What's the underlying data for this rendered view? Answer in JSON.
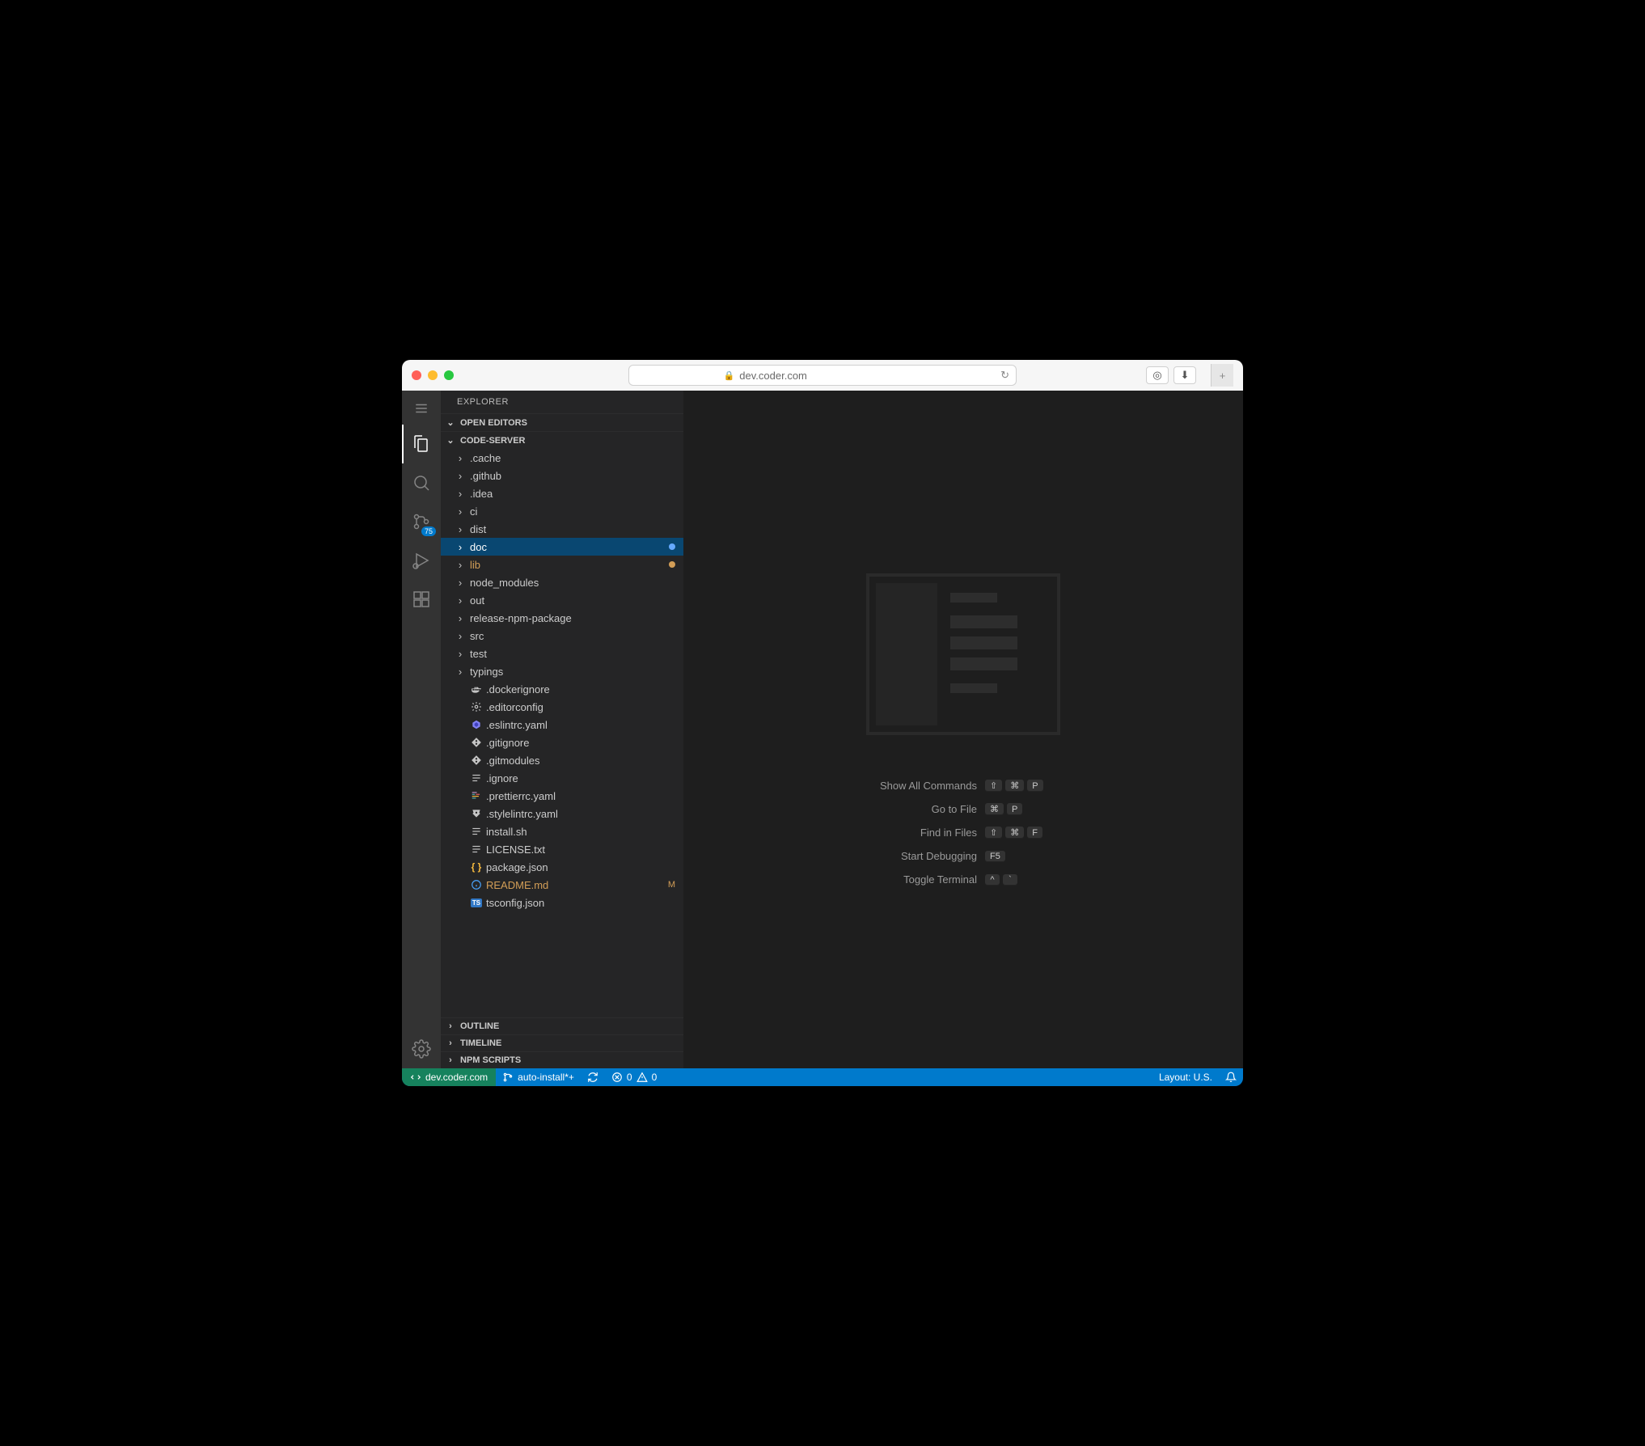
{
  "browser": {
    "url": "dev.coder.com"
  },
  "sidebar": {
    "title": "EXPLORER",
    "sections": {
      "openEditors": "OPEN EDITORS",
      "workspace": "CODE-SERVER",
      "outline": "OUTLINE",
      "timeline": "TIMELINE",
      "npmScripts": "NPM SCRIPTS"
    },
    "tree": [
      {
        "type": "folder",
        "label": ".cache"
      },
      {
        "type": "folder",
        "label": ".github"
      },
      {
        "type": "folder",
        "label": ".idea"
      },
      {
        "type": "folder",
        "label": "ci"
      },
      {
        "type": "folder",
        "label": "dist"
      },
      {
        "type": "folder",
        "label": "doc",
        "selected": true,
        "dotColor": "#66aaff"
      },
      {
        "type": "folder",
        "label": "lib",
        "modified": true,
        "dotColor": "#d39e57"
      },
      {
        "type": "folder",
        "label": "node_modules"
      },
      {
        "type": "folder",
        "label": "out"
      },
      {
        "type": "folder",
        "label": "release-npm-package"
      },
      {
        "type": "folder",
        "label": "src"
      },
      {
        "type": "folder",
        "label": "test"
      },
      {
        "type": "folder",
        "label": "typings"
      },
      {
        "type": "file",
        "label": ".dockerignore",
        "icon": "docker"
      },
      {
        "type": "file",
        "label": ".editorconfig",
        "icon": "gear"
      },
      {
        "type": "file",
        "label": ".eslintrc.yaml",
        "icon": "eslint"
      },
      {
        "type": "file",
        "label": ".gitignore",
        "icon": "git"
      },
      {
        "type": "file",
        "label": ".gitmodules",
        "icon": "git"
      },
      {
        "type": "file",
        "label": ".ignore",
        "icon": "text"
      },
      {
        "type": "file",
        "label": ".prettierrc.yaml",
        "icon": "prettier"
      },
      {
        "type": "file",
        "label": ".stylelintrc.yaml",
        "icon": "stylelint"
      },
      {
        "type": "file",
        "label": "install.sh",
        "icon": "text"
      },
      {
        "type": "file",
        "label": "LICENSE.txt",
        "icon": "text"
      },
      {
        "type": "file",
        "label": "package.json",
        "icon": "json"
      },
      {
        "type": "file",
        "label": "README.md",
        "icon": "info",
        "modified": true,
        "deco": "M"
      },
      {
        "type": "file",
        "label": "tsconfig.json",
        "icon": "ts"
      }
    ]
  },
  "activity": {
    "scmBadge": "75"
  },
  "welcome": {
    "shortcuts": [
      {
        "label": "Show All Commands",
        "keys": [
          "⇧",
          "⌘",
          "P"
        ]
      },
      {
        "label": "Go to File",
        "keys": [
          "⌘",
          "P"
        ]
      },
      {
        "label": "Find in Files",
        "keys": [
          "⇧",
          "⌘",
          "F"
        ]
      },
      {
        "label": "Start Debugging",
        "keys": [
          "F5"
        ]
      },
      {
        "label": "Toggle Terminal",
        "keys": [
          "^",
          "`"
        ]
      }
    ]
  },
  "statusbar": {
    "remote": "dev.coder.com",
    "branch": "auto-install*+",
    "errors": "0",
    "warnings": "0",
    "layout": "Layout: U.S."
  }
}
